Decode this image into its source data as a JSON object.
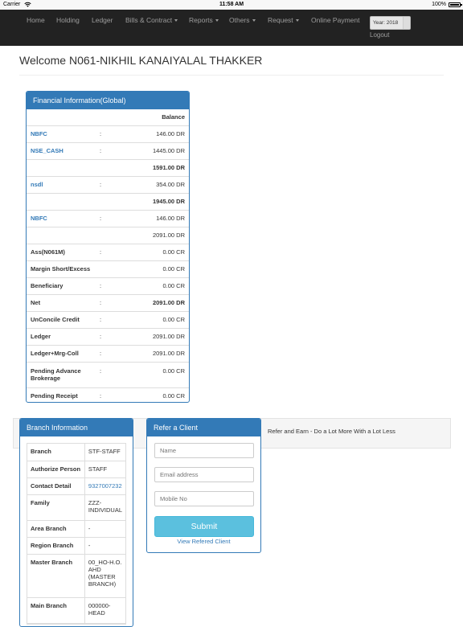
{
  "status_bar": {
    "carrier": "Carrier",
    "time": "11:58 AM",
    "battery": "100%"
  },
  "nav": {
    "items": [
      "Home",
      "Holding",
      "Ledger",
      "Bills & Contract",
      "Reports",
      "Others",
      "Request",
      "Online Payment"
    ],
    "year_label": "Year: 2018",
    "logout": "Logout"
  },
  "welcome": "Welcome N061-NIKHIL KANAIYALAL THAKKER",
  "financial": {
    "title": "Financial Information(Global)",
    "balance_header": "Balance",
    "rows": [
      {
        "label": "NBFC",
        "sep": ":",
        "value": "146.00 DR"
      },
      {
        "label": "NSE_CASH",
        "sep": ":",
        "value": "1445.00 DR"
      },
      {
        "label": "",
        "sep": "",
        "value": "1591.00 DR"
      },
      {
        "label": "nsdl",
        "sep": ":",
        "value": "354.00 DR"
      },
      {
        "label": "",
        "sep": "",
        "value": "1945.00 DR"
      },
      {
        "label": "NBFC",
        "sep": ":",
        "value": "146.00 DR"
      },
      {
        "label": "",
        "sep": "",
        "value": "2091.00 DR"
      },
      {
        "label": "Ass(N061M)",
        "sep": ":",
        "value": "0.00 CR"
      },
      {
        "label": "Margin Short/Excess",
        "sep": "",
        "value": "0.00 CR"
      },
      {
        "label": "Beneficiary",
        "sep": ":",
        "value": "0.00 CR"
      },
      {
        "label": "Net",
        "sep": ":",
        "value": "2091.00 DR"
      },
      {
        "label": "UnConcile Credit",
        "sep": ":",
        "value": "0.00 CR"
      },
      {
        "label": "Ledger",
        "sep": ":",
        "value": "2091.00 DR"
      },
      {
        "label": "Ledger+Mrg-Coll",
        "sep": ":",
        "value": "2091.00 DR"
      },
      {
        "label": "Pending Advance Brokerage",
        "sep": ":",
        "value": "0.00 CR"
      },
      {
        "label": "Pending Receipt",
        "sep": ":",
        "value": "0.00 CR"
      }
    ]
  },
  "branch": {
    "title": "Branch Information",
    "rows": [
      {
        "label": "Branch",
        "value": "STF-STAFF"
      },
      {
        "label": "Authorize Person",
        "value": "STAFF"
      },
      {
        "label": "Contact Detail",
        "value": "9327007232"
      },
      {
        "label": "Family",
        "value": "ZZZ-INDIVIDUAL"
      },
      {
        "label": "Area Branch",
        "value": "-"
      },
      {
        "label": "Region Branch",
        "value": "-"
      },
      {
        "label": "Master Branch",
        "value": "00_HO-H.O. AHD (MASTER BRANCH)"
      },
      {
        "label": "Main Branch",
        "value": "000000-HEAD"
      }
    ]
  },
  "refer": {
    "title": "Refer a Client",
    "name_placeholder": "Name",
    "email_placeholder": "Email address",
    "mobile_placeholder": "Mobile No",
    "submit": "Submit",
    "view_link": "View Refered Client",
    "tagline": "Refer and Earn - Do a Lot More With a Lot Less"
  }
}
